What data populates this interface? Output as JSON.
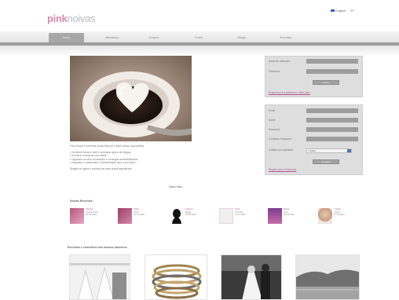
{
  "header": {
    "logo_part1": "pink",
    "logo_part2": "noivas",
    "lang_english": "English",
    "lang_other": "PT"
  },
  "nav": {
    "tabs": [
      {
        "label": "Início",
        "active": true
      },
      {
        "label": "Membros",
        "active": false
      },
      {
        "label": "Grupos",
        "active": false
      },
      {
        "label": "Fotos",
        "active": false
      },
      {
        "label": "Blogs",
        "active": false
      },
      {
        "label": "Eventos",
        "active": false
      }
    ]
  },
  "intro": {
    "lead": "Pink Noivas é uma rede social feita por e para noivas. Aqui poderá:",
    "bullets": [
      "Conhecer Noivas, fazer e conseguir grupo de amigas",
      "Conhecer noivas da sua cidade",
      "Organizar os seus convidados e conseguir aconselhamento",
      "Organizar o casamento e a presentação para a sua boda"
    ],
    "footer": "Registe-se agora e conheça as suas outras agradáveis!",
    "read_more": "Saber Mais..."
  },
  "login": {
    "user_label": "Nome de Utilizador",
    "password_label": "Password",
    "submit_label": "Entrar",
    "forgot_link": "Esqueceu-se a password, clique aqui"
  },
  "register": {
    "email_label": "Email",
    "username_label": "Nome",
    "password_label": "Password",
    "confirm_label": "Confirmar Password",
    "city_label": "Cidade ou Localidade",
    "city_value": "Lisboa",
    "submit_label": "Registar",
    "terms_link": "Registo com o Facebook"
  },
  "members_section": {
    "title": "Noivas Recentes",
    "members": [
      {
        "name": "Patricia",
        "detail": "Lisboa Norte",
        "extra": "22.09.2010",
        "tone": "pink"
      },
      {
        "name": "Carla",
        "detail": "Porto",
        "extra": "31.10.2010",
        "tone": "pink"
      },
      {
        "name": "Adriana",
        "detail": "Braga",
        "extra": "25.08.2010",
        "tone": "silhouette"
      },
      {
        "name": "Sofia",
        "detail": "Coimbra",
        "extra": "11.07.2011",
        "tone": "white"
      },
      {
        "name": "Marta",
        "detail": "Faro",
        "extra": "03.06.2011",
        "tone": "violet"
      },
      {
        "name": "Angela",
        "detail": "Lisboa",
        "extra": "17.04.2011",
        "tone": "portrait"
      }
    ]
  },
  "gallery_section": {
    "title": "Escolhas e conselhos dos nossos parceiros"
  },
  "colors": {
    "brand_pink": "#d58ab0",
    "link": "#b55a90",
    "nav_active": "#a7a7a7",
    "panel": "#dedede"
  }
}
